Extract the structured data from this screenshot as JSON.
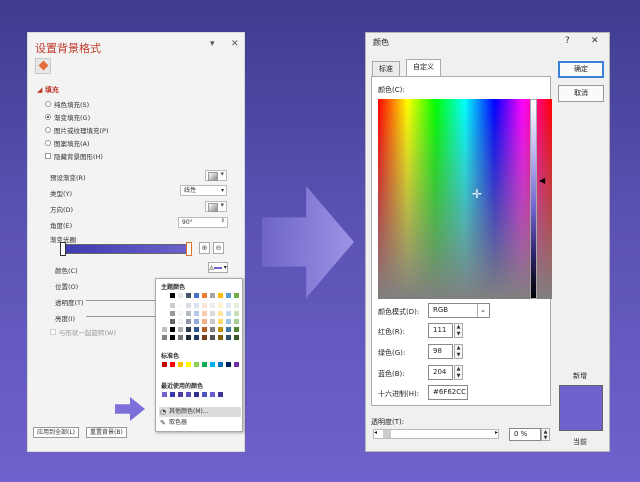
{
  "left_panel": {
    "title": "设置背景格式",
    "pin_glyph": "▾",
    "close_glyph": "✕",
    "fill_section": "填充",
    "fill_options": [
      {
        "label": "纯色填充(S)",
        "selected": false
      },
      {
        "label": "渐变填充(G)",
        "selected": true
      },
      {
        "label": "图片或纹理填充(P)",
        "selected": false
      },
      {
        "label": "图案填充(A)",
        "selected": false
      }
    ],
    "hide_bg_label": "隐藏背景图形(H)",
    "preset_label": "预设渐变(R)",
    "type_label": "类型(Y)",
    "type_value": "线性",
    "direction_label": "方向(D)",
    "angle_label": "角度(E)",
    "angle_value": "90°",
    "stops_label": "渐变光圈",
    "color_label": "颜色(C)",
    "position_label": "位置(O)",
    "transparency_label": "透明度(T)",
    "brightness_label": "亮度(I)",
    "rotate_label": "与形状一起旋转(W)",
    "apply_all": "应用到全部(L)",
    "reset_bg": "重置背景(B)"
  },
  "popup": {
    "theme_colors": "主题颜色",
    "standard_colors": "标准色",
    "recent_colors": "最近使用的颜色",
    "more_colors": "其他颜色(M)...",
    "eyedropper": "取色器",
    "theme_row": [
      "#ffffff",
      "#000000",
      "#e7e6e6",
      "#44546a",
      "#4472c4",
      "#ed7d31",
      "#a5a5a5",
      "#ffc000",
      "#5b9bd5",
      "#70ad47"
    ],
    "standard_row": [
      "#c00000",
      "#ff0000",
      "#ffc000",
      "#ffff00",
      "#92d050",
      "#00b050",
      "#00b0f0",
      "#0070c0",
      "#002060",
      "#7030a0"
    ],
    "recent_row": [
      "#6f62cc",
      "#3a3ab0",
      "#4b3fa0",
      "#5b4fbf",
      "#2f2f8f",
      "#4a52c0",
      "#6a5fd0",
      "#3d3599"
    ]
  },
  "dialog": {
    "title": "颜色",
    "help": "?",
    "close": "✕",
    "tab_standard": "标准",
    "tab_custom": "自定义",
    "colors_label": "颜色(C):",
    "model_label": "颜色模式(D):",
    "model_value": "RGB",
    "red_label": "红色(R):",
    "red_value": "111",
    "green_label": "绿色(G):",
    "green_value": "98",
    "blue_label": "蓝色(B):",
    "blue_value": "204",
    "hex_label": "十六进制(H):",
    "hex_value": "#6F62CC",
    "transparency_label": "透明度(T):",
    "transparency_value": "0 %",
    "ok": "确定",
    "cancel": "取消",
    "new_label": "新增",
    "current_label": "当前"
  }
}
